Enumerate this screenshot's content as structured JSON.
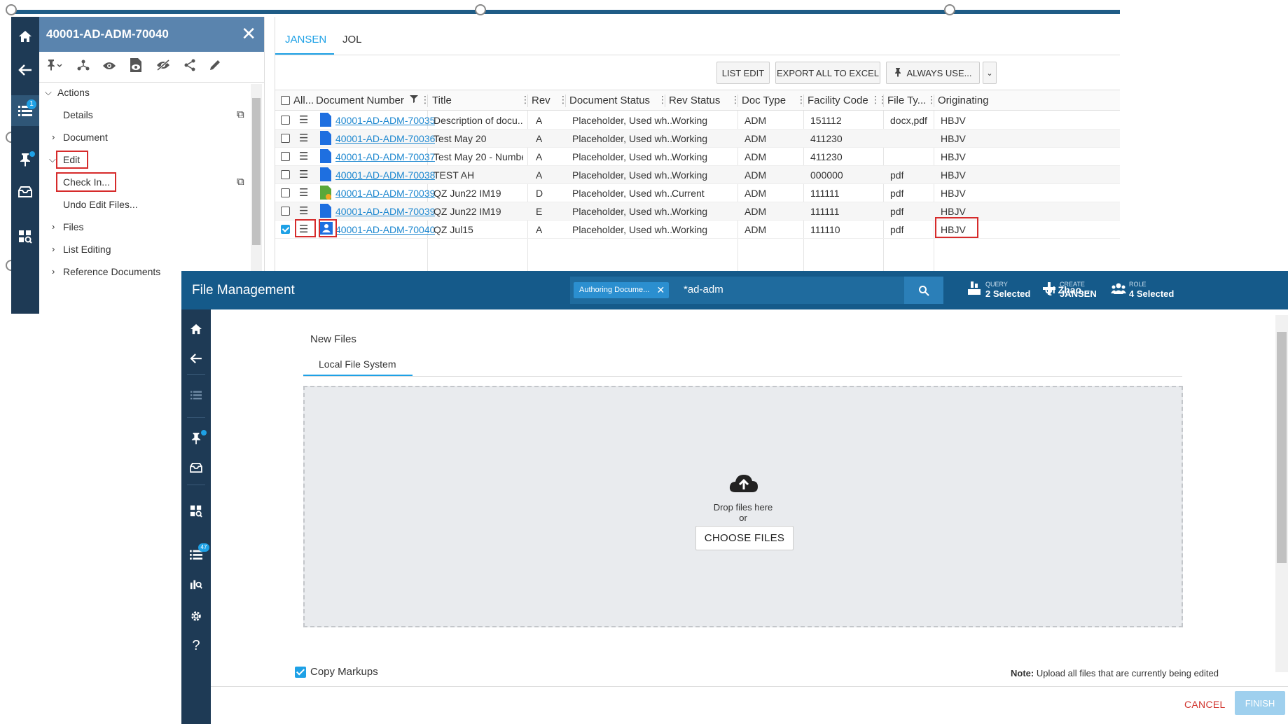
{
  "back_window": {
    "panel_title": "40001-AD-ADM-70040",
    "rail_badge": "1",
    "tree": [
      {
        "label": "Actions"
      },
      {
        "label": "Details"
      },
      {
        "label": "Document"
      },
      {
        "label": "Edit"
      },
      {
        "label": "Check In..."
      },
      {
        "label": "Undo Edit Files..."
      },
      {
        "label": "Files"
      },
      {
        "label": "List Editing"
      },
      {
        "label": "Reference Documents"
      }
    ],
    "tabs": [
      "JANSEN",
      "JOL"
    ],
    "toolbar": {
      "list_edit": "LIST EDIT",
      "export": "EXPORT ALL TO EXCEL",
      "always_use": "ALWAYS USE..."
    },
    "columns": {
      "all": "All...",
      "doc_number": "Document Number",
      "title": "Title",
      "rev": "Rev",
      "doc_status": "Document Status",
      "rev_status": "Rev Status",
      "doc_type": "Doc Type",
      "facility_code": "Facility Code",
      "file_type": "File Ty...",
      "originating": "Originating"
    },
    "rows": [
      {
        "number": "40001-AD-ADM-70035",
        "title": "Description of docu...",
        "rev": "A",
        "status": "Placeholder, Used wh...",
        "rev_status": "Working",
        "doc_type": "ADM",
        "facility": "151112",
        "file_type": "docx,pdf",
        "orig": "HBJV"
      },
      {
        "number": "40001-AD-ADM-70036",
        "title": "Test May 20",
        "rev": "A",
        "status": "Placeholder, Used wh...",
        "rev_status": "Working",
        "doc_type": "ADM",
        "facility": "411230",
        "file_type": "",
        "orig": "HBJV"
      },
      {
        "number": "40001-AD-ADM-70037",
        "title": "Test May 20 - Numbe...",
        "rev": "A",
        "status": "Placeholder, Used wh...",
        "rev_status": "Working",
        "doc_type": "ADM",
        "facility": "411230",
        "file_type": "",
        "orig": "HBJV"
      },
      {
        "number": "40001-AD-ADM-70038",
        "title": "TEST AH",
        "rev": "A",
        "status": "Placeholder, Used wh...",
        "rev_status": "Working",
        "doc_type": "ADM",
        "facility": "000000",
        "file_type": "pdf",
        "orig": "HBJV"
      },
      {
        "number": "40001-AD-ADM-70039",
        "title": "QZ Jun22 IM19",
        "rev": "D",
        "status": "Placeholder, Used wh...",
        "rev_status": "Current",
        "doc_type": "ADM",
        "facility": "111111",
        "file_type": "pdf",
        "orig": "HBJV"
      },
      {
        "number": "40001-AD-ADM-70039",
        "title": "QZ Jun22 IM19",
        "rev": "E",
        "status": "Placeholder, Used wh...",
        "rev_status": "Working",
        "doc_type": "ADM",
        "facility": "111111",
        "file_type": "pdf",
        "orig": "HBJV"
      },
      {
        "number": "40001-AD-ADM-70040",
        "title": "QZ Jul15",
        "rev": "A",
        "status": "Placeholder, Used wh...",
        "rev_status": "Working",
        "doc_type": "ADM",
        "facility": "111110",
        "file_type": "pdf",
        "orig": "HBJV"
      }
    ]
  },
  "file_management": {
    "title": "File Management",
    "search_chip": "Authoring Docume...",
    "search_text": "*ad-adm",
    "query_small": "QUERY",
    "query_big": "2 Selected",
    "create_small": "CREATE",
    "create_big": "JANSEN",
    "role_small": "ROLE",
    "role_big": "4 Selected",
    "user": "Qi Zhao...",
    "rail_badge": "47",
    "section_title": "New Files",
    "tab_label": "Local File System",
    "drop_text": "Drop files here",
    "drop_or": "or",
    "choose_files": "CHOOSE FILES",
    "copy_markups": "Copy Markups",
    "note_label": "Note:",
    "note_text": "Upload all files that are currently being edited",
    "cancel": "CANCEL",
    "finish": "FINISH"
  },
  "colors": {
    "header_blue": "#155a8a",
    "rail_dark": "#1e3a55",
    "accent": "#1ea1e6",
    "highlight_red": "#d62b2b",
    "cancel_red": "#d0322b"
  }
}
